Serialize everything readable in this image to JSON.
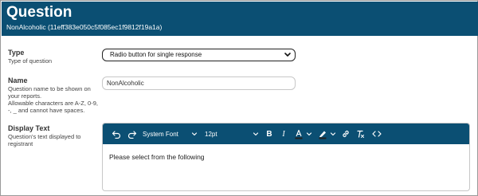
{
  "header": {
    "title": "Question",
    "subtitle": "NonAlcoholic (11eff383e050c5f085ec1f9812f19a1a)"
  },
  "fields": {
    "type": {
      "label": "Type",
      "description": "Type of question",
      "selected": "Radio button for single response"
    },
    "name": {
      "label": "Name",
      "description_lines": [
        "Question name to be shown on",
        "your reports.",
        "Allowable characters are A-Z, 0-9,",
        "-, _ and cannot have spaces."
      ],
      "value": "NonAlcoholic"
    },
    "display_text": {
      "label": "Display Text",
      "description_lines": [
        "Question's text displayed to",
        "registrant"
      ],
      "content": "Please select from the following"
    }
  },
  "editor_toolbar": {
    "font_family": "System Font",
    "font_size": "12pt",
    "icons": [
      "undo-icon",
      "redo-icon",
      "bold-icon",
      "italic-icon",
      "text-color-icon",
      "highlight-icon",
      "link-icon",
      "clear-format-icon",
      "code-icon"
    ]
  },
  "colors": {
    "header_bg": "#0b4f73",
    "text_color_underline": "#222222"
  }
}
